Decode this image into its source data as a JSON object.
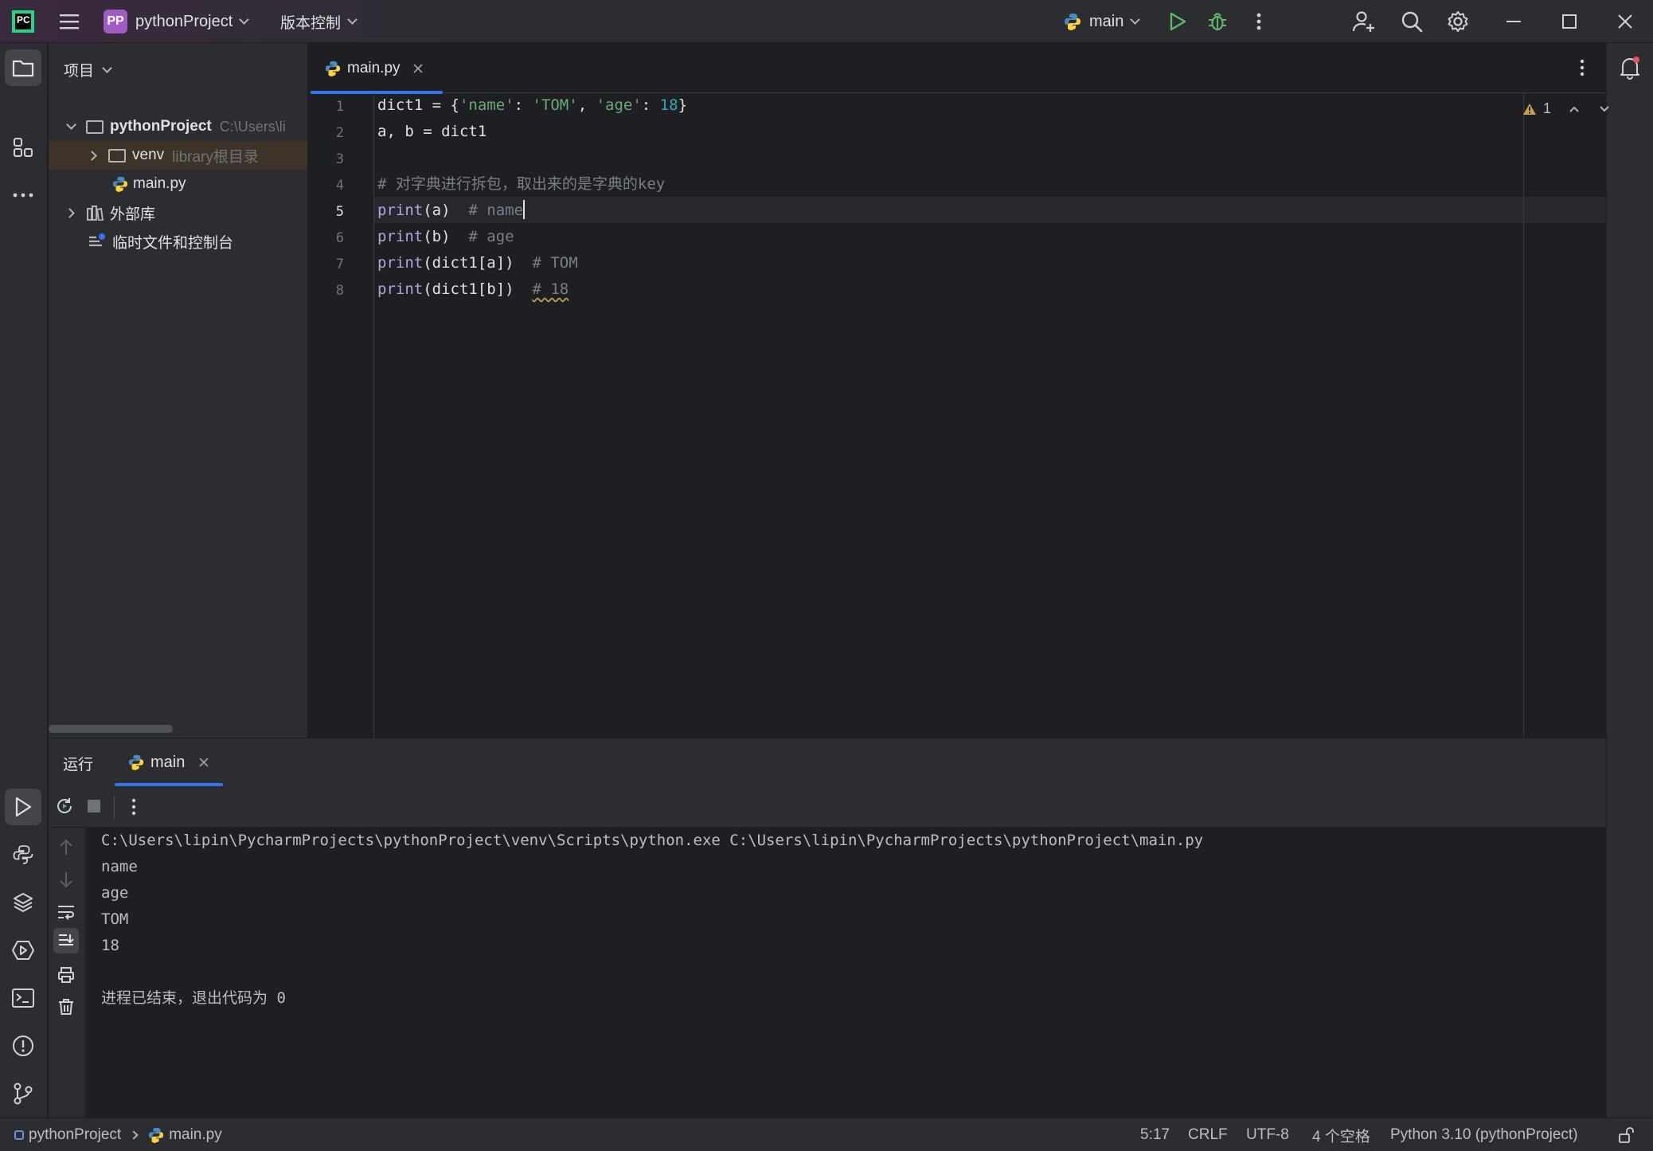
{
  "titlebar": {
    "project_badge": "PP",
    "project_name": "pythonProject",
    "vcs_label": "版本控制",
    "run_config": "main"
  },
  "project_panel": {
    "title": "项目",
    "items": [
      {
        "label": "pythonProject",
        "hint": "C:\\Users\\li"
      },
      {
        "label": "venv",
        "hint": "library根目录"
      },
      {
        "label": "main.py",
        "hint": ""
      },
      {
        "label": "外部库",
        "hint": ""
      },
      {
        "label": "临时文件和控制台",
        "hint": ""
      }
    ]
  },
  "editor": {
    "tab_label": "main.py",
    "warnings_count": "1",
    "line_numbers": [
      "1",
      "2",
      "3",
      "4",
      "5",
      "6",
      "7",
      "8"
    ],
    "current_line": 5,
    "code": [
      "dict1 = {'name': 'TOM', 'age': 18}",
      "a, b = dict1",
      "",
      "# 对字典进行拆包，取出来的是字典的key",
      "print(a)  # name",
      "print(b)  # age",
      "print(dict1[a])  # TOM",
      "print(dict1[b])  # 18"
    ]
  },
  "run_panel": {
    "title": "运行",
    "tab_label": "main",
    "output": [
      "C:\\Users\\lipin\\PycharmProjects\\pythonProject\\venv\\Scripts\\python.exe C:\\Users\\lipin\\PycharmProjects\\pythonProject\\main.py",
      "name",
      "age",
      "TOM",
      "18",
      "",
      "进程已结束，退出代码为 0"
    ]
  },
  "statusbar": {
    "breadcrumb_project": "pythonProject",
    "breadcrumb_file": "main.py",
    "position": "5:17",
    "line_sep": "CRLF",
    "encoding": "UTF-8",
    "indent": "4 个空格",
    "interpreter": "Python 3.10 (pythonProject)"
  },
  "colors": {
    "accent": "#3574f0",
    "run_green": "#5fb865",
    "project_badge": "#a05cc0",
    "notification_dot": "#e55765"
  }
}
